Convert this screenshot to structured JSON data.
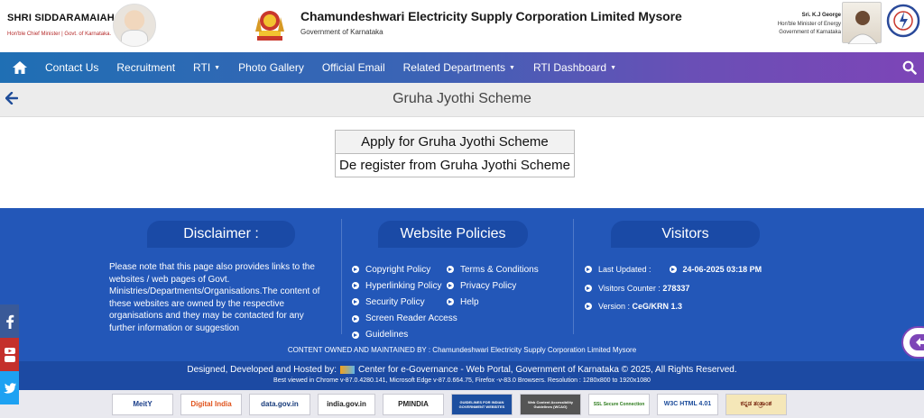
{
  "header": {
    "cm_name": "SHRI SIDDARAMAIAH",
    "cm_role": "Hon'ble Chief Minister | Govt. of Karnataka.",
    "org_title": "Chamundeshwari Electricity Supply Corporation Limited Mysore",
    "org_subtitle": "Government of Karnataka",
    "minister_name": "Sri. K.J George",
    "minister_role": "Hon'ble Minister of Energy",
    "minister_gov": "Government of Karnataka"
  },
  "nav": {
    "items": [
      "Contact Us",
      "Recruitment",
      "RTI",
      "Photo Gallery",
      "Official Email",
      "Related Departments",
      "RTI Dashboard"
    ],
    "dropdown_caret": "▼"
  },
  "page": {
    "title": "Gruha Jyothi Scheme",
    "links": [
      "Apply for Gruha Jyothi Scheme",
      "De register from Gruha Jyothi Scheme"
    ]
  },
  "footer": {
    "disclaimer_heading": "Disclaimer :",
    "disclaimer_text": "Please note that this page also provides links to the websites / web pages of Govt. Ministries/Departments/Organisations.The content of these websites are owned by the respective organisations and they may be contacted for any further information or suggestion",
    "policies_heading": "Website Policies",
    "policies_col1": [
      "Copyright Policy",
      "Hyperlinking Policy",
      "Security Policy",
      "Screen Reader Access",
      "Guidelines"
    ],
    "policies_col2": [
      "Terms & Conditions",
      "Privacy Policy",
      "Help"
    ],
    "visitors_heading": "Visitors",
    "last_updated_label": "Last Updated :",
    "last_updated_value": "24-06-2025 03:18 PM",
    "visitors_counter_label": "Visitors Counter :",
    "visitors_counter_value": "278337",
    "version_label": "Version :",
    "version_value": "CeG/KRN 1.3",
    "maintained": "CONTENT OWNED AND MAINTAINED BY : Chamundeshwari Electricity Supply Corporation Limited Mysore",
    "designed_prefix": "Designed, Developed and Hosted by:",
    "designed_suffix": "Center for e-Governance - Web Portal, Government of Karnataka © 2025, All Rights Reserved.",
    "best_viewed": "Best viewed in Chrome v-87.0.4280.141, Microsoft Edge v-87.0.664.75, Firefox -v-83.0 Browsers. Resolution : 1280x800 to 1920x1080"
  },
  "logos": [
    "MeitY",
    "Digital India",
    "data.gov.in",
    "india.gov.in",
    "PMINDIA",
    "GUIDELINES FOR INDIAN GOVERNMENT WEBSITES",
    "Web Content Accessibility Guidelines (WCAG)",
    "SSL Secure Connection",
    "W3C HTML 4.01",
    "ಕನ್ನಡ ತಂತ್ರಾಂಶ"
  ],
  "colors": {
    "nav_start": "#1f6fb4",
    "nav_end": "#7d45b7",
    "footer_bg": "#2357b8"
  }
}
